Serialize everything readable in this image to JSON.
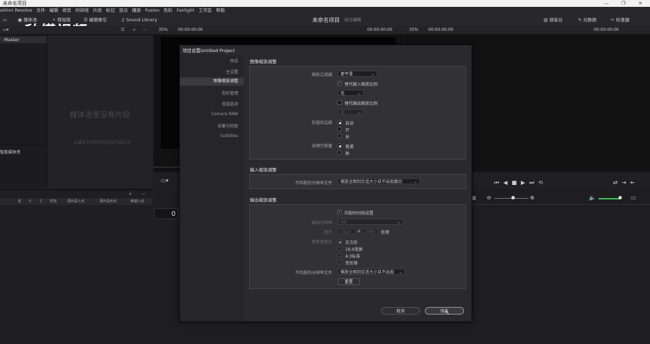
{
  "window": {
    "title": "未命名项目",
    "controls": [
      "—",
      "❐",
      "✕"
    ]
  },
  "menu": [
    "aVinci Resolve",
    "文件",
    "编辑",
    "修剪",
    "时间线",
    "片段",
    "标记",
    "显示",
    "播放",
    "Fusion",
    "色彩",
    "Fairlight",
    "工作区",
    "帮助"
  ],
  "toolbar": {
    "media_pool": "媒体池",
    "effects": "特效库",
    "edit_index": "编辑索引",
    "sound_library": "Sound Library",
    "project_title": "未命名项目",
    "project_sub": "经过编辑",
    "mixer": "调音台",
    "metadata": "元数据",
    "inspector": "检查器"
  },
  "watermark": "秒懂视频",
  "strip2": {
    "zoom_left": "35%",
    "tc_left": "00:00:00:00",
    "tc_left2": "00:00:00:00",
    "zoom_right": "35%",
    "tc_right": "00:00:00:00",
    "tc_right2": "00:00:00:00"
  },
  "mediapool": {
    "bin_master": "Master",
    "empty_title": "媒体池里没有片段",
    "empty_hint": "从媒体存储里添加片段开始工作",
    "smart_bins": "智能媒体夹"
  },
  "list_headers": [
    "名",
    "V",
    "C",
    "时长",
    "源片段入点",
    "源片段出点",
    "帧速入点"
  ],
  "timeline": {
    "timecode": "0"
  },
  "dialog": {
    "title": "项目设置Untitled Project",
    "sidebar": [
      "预设",
      "主设置",
      "图像缩放调整",
      "色彩管理",
      "常规选项",
      "Camera RAW",
      "采集与回放",
      "Subtitles"
    ],
    "sec_image": {
      "title": "图像缩放调整",
      "filter_label": "缩放过滤器",
      "filter_value": "更平滑",
      "override_input": "替代输入缩放比例",
      "input_value": "无",
      "override_output": "替代输出缩放比例",
      "output_value": "无",
      "antialias_label": "抗锯齿边缘",
      "antialias_opts": [
        "自动",
        "开",
        "关"
      ],
      "deinterlace_label": "去隔行质量",
      "deinterlace_opts": [
        "普通",
        "高"
      ]
    },
    "sec_input": {
      "title": "输入缩放调整",
      "mismatch_label": "不匹配的分辨率文件",
      "mismatch_value": "缩放全图到合适大小且不出现裁切"
    },
    "sec_output": {
      "title": "输出缩放调整",
      "match_timeline": "匹配时间线设置",
      "res_label": "输出分辨率",
      "res_value": "HD",
      "for_label": "用于",
      "width": "1920",
      "x": "x",
      "height": "1080",
      "px": "处理",
      "aspect_label": "像素宽高比",
      "aspect_opts": [
        "正方形",
        "16:9宽屏",
        "4:3标准",
        "变形镜"
      ],
      "mismatch_label": "不匹配的分辨率文件",
      "mismatch_value": "缩放全图到合适大小且不出现",
      "reset": "重置"
    },
    "cancel": "取消",
    "save": "保存"
  }
}
